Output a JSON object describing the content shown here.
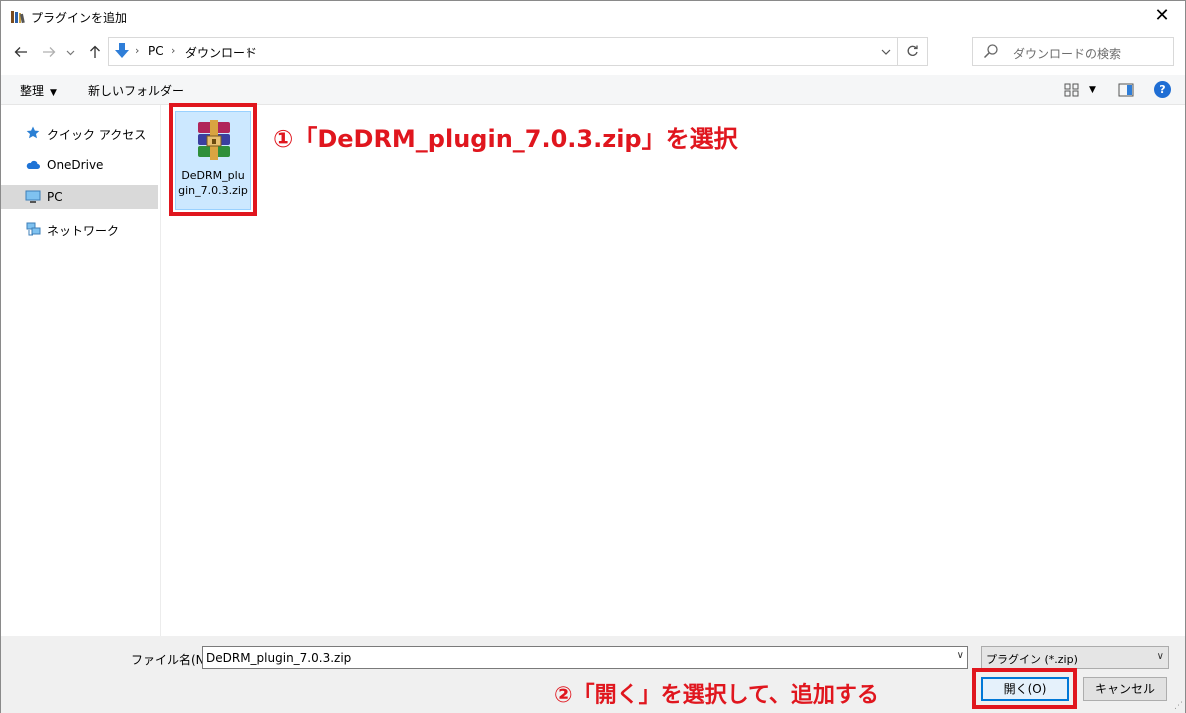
{
  "window": {
    "title": "プラグインを追加",
    "close_label": "✕"
  },
  "address": {
    "crumbs": [
      "PC",
      "ダウンロード"
    ],
    "separator": "›"
  },
  "search": {
    "placeholder": "ダウンロードの検索"
  },
  "toolbar": {
    "organize_label": "整理",
    "new_folder_label": "新しいフォルダー",
    "help_label": "?"
  },
  "sidebar": {
    "items": [
      {
        "label": "クイック アクセス",
        "icon": "star-icon"
      },
      {
        "label": "OneDrive",
        "icon": "cloud-icon"
      },
      {
        "label": "PC",
        "icon": "computer-icon",
        "selected": true
      },
      {
        "label": "ネットワーク",
        "icon": "network-icon"
      }
    ]
  },
  "files": [
    {
      "name": "DeDRM_plugin_7.0.3.zip",
      "icon": "winrar-archive-icon",
      "selected": true
    }
  ],
  "annotations": {
    "step1": "①「DeDRM_plugin_7.0.3.zip」を選択",
    "step2": "②「開く」を選択して、追加する"
  },
  "bottom": {
    "filename_label": "ファイル名(N):",
    "filename_value": "DeDRM_plugin_7.0.3.zip",
    "filetype_value": "プラグイン (*.zip)",
    "open_label": "開く(O)",
    "cancel_label": "キャンセル"
  },
  "colors": {
    "annotation_red": "#e0161e",
    "selection_blue": "#cce8ff",
    "accent": "#0078d7"
  }
}
